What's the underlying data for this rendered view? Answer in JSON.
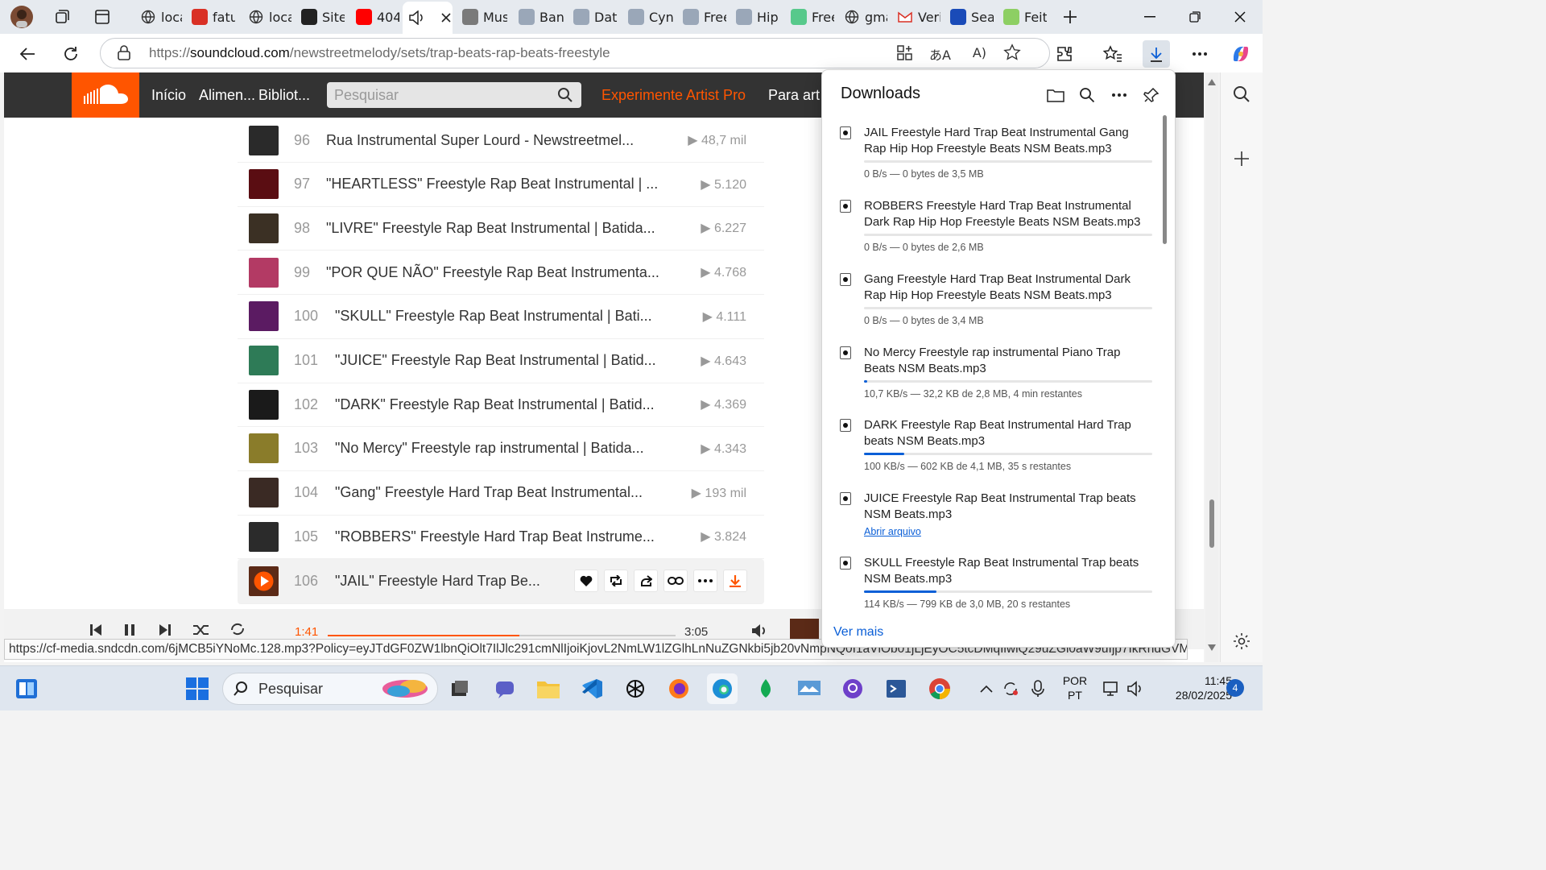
{
  "browser": {
    "tabs": [
      {
        "label": "loca",
        "icon": "globe-icon"
      },
      {
        "label": "fatu",
        "icon": "pdf-icon"
      },
      {
        "label": "loca",
        "icon": "globe-icon"
      },
      {
        "label": "Site",
        "icon": "openai-icon"
      },
      {
        "label": "404",
        "icon": "youtube-icon"
      },
      {
        "label": "",
        "icon": "speaker-icon",
        "active": true
      },
      {
        "label": "Mus",
        "icon": "bing-icon"
      },
      {
        "label": "Ban",
        "icon": "page-icon"
      },
      {
        "label": "Dat",
        "icon": "page-icon"
      },
      {
        "label": "Cyn",
        "icon": "page-icon"
      },
      {
        "label": "Free",
        "icon": "page-icon"
      },
      {
        "label": "Hip",
        "icon": "page-icon"
      },
      {
        "label": "Free",
        "icon": "pexels-icon"
      },
      {
        "label": "gma",
        "icon": "search-icon"
      },
      {
        "label": "Veri",
        "icon": "gmail-icon"
      },
      {
        "label": "Sea",
        "icon": "fma-icon"
      },
      {
        "label": "Feit",
        "icon": "shield-icon"
      }
    ],
    "url_prefix": "https://",
    "url_domain": "soundcloud.com",
    "url_path": "/newstreetmelody/sets/trap-beats-rap-beats-freestyle"
  },
  "soundcloud": {
    "nav": [
      "Início",
      "Alimen...",
      "Bibliot..."
    ],
    "search_placeholder": "Pesquisar",
    "pro_link": "Experimente Artist Pro",
    "artists_link": "Para art",
    "tracks": [
      {
        "num": "96",
        "title": "Rua Instrumental Super Lourd - Newstreetmel...",
        "plays": "▶ 48,7 mil",
        "color": "#2a2a2a"
      },
      {
        "num": "97",
        "title": "\"HEARTLESS\" Freestyle Rap Beat Instrumental | ...",
        "plays": "▶ 5.120",
        "color": "#5a0d12"
      },
      {
        "num": "98",
        "title": "\"LIVRE\" Freestyle Rap Beat Instrumental | Batida...",
        "plays": "▶ 6.227",
        "color": "#3b3024"
      },
      {
        "num": "99",
        "title": "\"POR QUE NÃO\" Freestyle Rap Beat Instrumenta...",
        "plays": "▶ 4.768",
        "color": "#b33a64"
      },
      {
        "num": "100",
        "title": "\"SKULL\" Freestyle Rap Beat Instrumental | Bati...",
        "plays": "▶ 4.111",
        "color": "#5b1b62"
      },
      {
        "num": "101",
        "title": "\"JUICE\" Freestyle Rap Beat Instrumental | Batid...",
        "plays": "▶ 4.643",
        "color": "#2e7b57"
      },
      {
        "num": "102",
        "title": "\"DARK\" Freestyle Rap Beat Instrumental | Batid...",
        "plays": "▶ 4.369",
        "color": "#1a1a1a"
      },
      {
        "num": "103",
        "title": "\"No Mercy\" Freestyle rap instrumental | Batida...",
        "plays": "▶ 4.343",
        "color": "#8a7c2a"
      },
      {
        "num": "104",
        "title": "\"Gang\" Freestyle Hard Trap Beat Instrumental...",
        "plays": "▶ 193 mil",
        "color": "#3a2a24"
      },
      {
        "num": "105",
        "title": "\"ROBBERS\" Freestyle Hard Trap Beat Instrume...",
        "plays": "▶ 3.824",
        "color": "#2b2b2b"
      },
      {
        "num": "106",
        "title": "\"JAIL\" Freestyle Hard Trap Be...",
        "plays": "",
        "color": "#5b2a17"
      }
    ],
    "player": {
      "elapsed": "1:41",
      "total": "3:05",
      "progress": 0.55
    }
  },
  "downloads": {
    "title": "Downloads",
    "items": [
      {
        "name": "JAIL Freestyle Hard Trap Beat Instrumental Gang Rap Hip Hop Freestyle Beats NSM Beats.mp3",
        "status": "0 B/s — 0 bytes de 3,5 MB",
        "progress": 0
      },
      {
        "name": "ROBBERS Freestyle Hard Trap Beat Instrumental Dark Rap Hip Hop Freestyle Beats NSM Beats.mp3",
        "status": "0 B/s — 0 bytes de 2,6 MB",
        "progress": 0
      },
      {
        "name": "Gang Freestyle Hard Trap Beat Instrumental Dark Rap Hip Hop Freestyle Beats NSM Beats.mp3",
        "status": "0 B/s — 0 bytes de 3,4 MB",
        "progress": 0
      },
      {
        "name": "No Mercy Freestyle rap instrumental Piano Trap Beats NSM Beats.mp3",
        "status": "10,7 KB/s — 32,2 KB de 2,8 MB, 4 min restantes",
        "progress": 0.01
      },
      {
        "name": "DARK Freestyle Rap Beat Instrumental Hard Trap beats NSM Beats.mp3",
        "status": "100 KB/s — 602 KB de 4,1 MB, 35 s restantes",
        "progress": 0.14
      },
      {
        "name": "JUICE Freestyle Rap Beat Instrumental Trap beats NSM Beats.mp3",
        "open_label": "Abrir arquivo",
        "done": true
      },
      {
        "name": "SKULL Freestyle Rap Beat Instrumental Trap beats NSM Beats.mp3",
        "status": "114 KB/s — 799 KB de 3,0 MB, 20 s restantes",
        "progress": 0.25
      }
    ],
    "more_label": "Ver mais"
  },
  "status_url": "https://cf-media.sndcdn.com/6jMCB5iYNoMc.128.mp3?Policy=eyJTdGF0ZW1lbnQiOlt7IlJlc291cmNlIjoiKjovL2NmLW1lZGlhLnNuZGNkbi5jb20vNmpNQ0I1aVlOb01jLjEyOC5tcDMqIiwiQ29uZGl0aW9uIjp7IkRhdGVMZXNzVGhhbi...",
  "taskbar": {
    "search_label": "Pesquisar",
    "lang_top": "POR",
    "lang_bottom": "PT",
    "time": "11:45",
    "date": "28/02/2025",
    "notifications": "4"
  }
}
